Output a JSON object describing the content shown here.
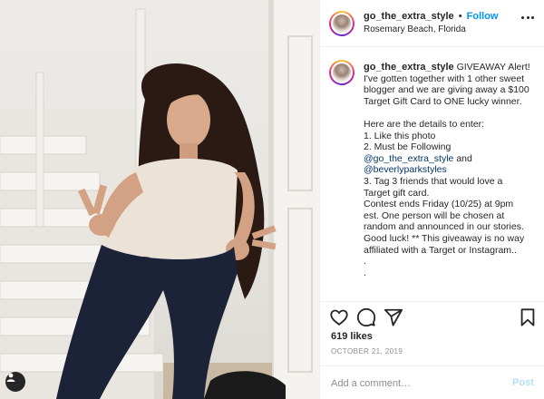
{
  "post": {
    "username": "go_the_extra_style",
    "follow_label": "Follow",
    "location": "Rosemary Beach, Florida",
    "caption_lines": [
      "GIVEAWAY Alert!",
      "I've gotten together with 1 other sweet",
      "blogger and we are giving away a $100",
      "Target Gift Card to ONE lucky winner.",
      "",
      "Here are the details to enter:",
      "1. Like this photo",
      "2. Must be Following",
      "@go_the_extra_style",
      "and",
      "@beverlyparkstyles",
      "3. Tag 3 friends that would love a",
      "Target gift card.",
      "Contest ends Friday (10/25) at 9pm",
      "est. One person will be chosen at",
      "random and announced in our stories.",
      "Good luck! ** This giveaway is no way",
      "affiliated with a Target or Instagram..",
      ".",
      "."
    ],
    "likes": "619 likes",
    "date": "OCTOBER 21, 2019"
  },
  "comment": {
    "placeholder": "Add a comment…",
    "post_label": "Post"
  },
  "icons": {
    "more": "more-options-icon",
    "like": "heart-icon",
    "comment": "comment-bubble-icon",
    "share": "paper-plane-icon",
    "save": "bookmark-icon",
    "tag": "person-tag-icon"
  },
  "colors": {
    "link": "#0095f6",
    "mention": "#00376b",
    "muted": "#8e8e8e",
    "post_disabled": "#b2dffc"
  }
}
